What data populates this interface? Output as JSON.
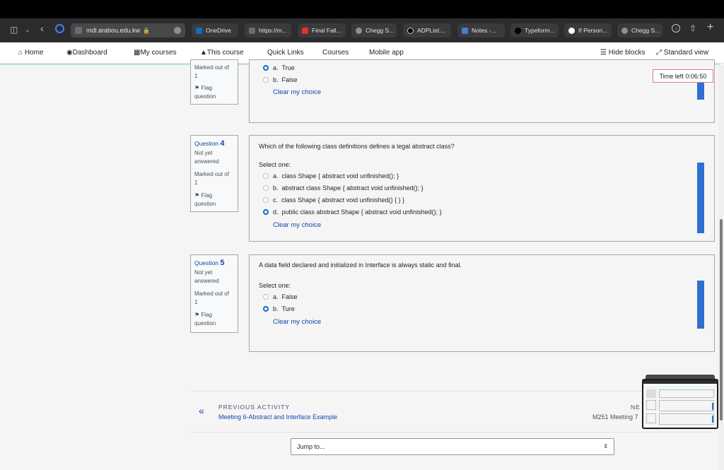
{
  "browser": {
    "url": "mdl.arabou.edu.kw",
    "tabs": [
      {
        "label": "OneDrive",
        "color": "#0f6cbf"
      },
      {
        "label": "https://m...",
        "color": "#6c6c70"
      },
      {
        "label": "Final Fall...",
        "color": "#e0332c"
      },
      {
        "label": "Chegg S...",
        "color": "#8e8e93"
      },
      {
        "label": "ADPList:...",
        "color": "#000000"
      },
      {
        "label": "Notes -...",
        "color": "#4a7bd6"
      },
      {
        "label": "Typeform...",
        "color": "#000000"
      },
      {
        "label": "If Person...",
        "color": "#ffffff"
      },
      {
        "label": "Chegg S...",
        "color": "#8e8e93"
      }
    ]
  },
  "nav": {
    "home": "Home",
    "dashboard": "Dashboard",
    "my_courses": "My courses",
    "this_course": "This course",
    "quick_links": "Quick Links",
    "courses": "Courses",
    "mobile_app": "Mobile app",
    "hide_blocks": "Hide blocks",
    "standard_view": "Standard view"
  },
  "timer": "Time left 0:06:50",
  "q3": {
    "marked": "Marked out of",
    "marked_val": "1",
    "flag": "Flag question",
    "options": [
      {
        "letter": "a.",
        "text": "True",
        "selected": true
      },
      {
        "letter": "b.",
        "text": "False",
        "selected": false
      }
    ],
    "clear": "Clear my choice"
  },
  "q4": {
    "label": "Question",
    "number": "4",
    "status": "Not yet answered",
    "marked": "Marked out of",
    "marked_val": "1",
    "flag": "Flag question",
    "text": "Which of the following class definitions defines a legal abstract class?",
    "select_one": "Select one:",
    "options": [
      {
        "letter": "a.",
        "text": "class Shape { abstract void unfinished(); }",
        "selected": false
      },
      {
        "letter": "b.",
        "text": "abstract class Shape { abstract void unfinished(); }",
        "selected": false
      },
      {
        "letter": "c.",
        "text": "class Shape { abstract void unfinished() { } }",
        "selected": false
      },
      {
        "letter": "d.",
        "text": "public class abstract Shape { abstract void unfinished(); }",
        "selected": true
      }
    ],
    "clear": "Clear my choice"
  },
  "q5": {
    "label": "Question",
    "number": "5",
    "status": "Not yet answered",
    "marked": "Marked out of",
    "marked_val": "1",
    "flag": "Flag question",
    "text": "A data field declared and initialized in Interface is always static and final.",
    "select_one": "Select one:",
    "options": [
      {
        "letter": "a.",
        "text": "False",
        "selected": false
      },
      {
        "letter": "b.",
        "text": "Ture",
        "selected": true
      }
    ],
    "clear": "Clear my choice"
  },
  "activity": {
    "prev_label": "PREVIOUS ACTIVITY",
    "prev_link": "Meeting 6-Abstract and Interface Example",
    "next_label": "NE",
    "next_link": "M251 Meeting 7"
  },
  "jump": {
    "label": "Jump to..."
  }
}
